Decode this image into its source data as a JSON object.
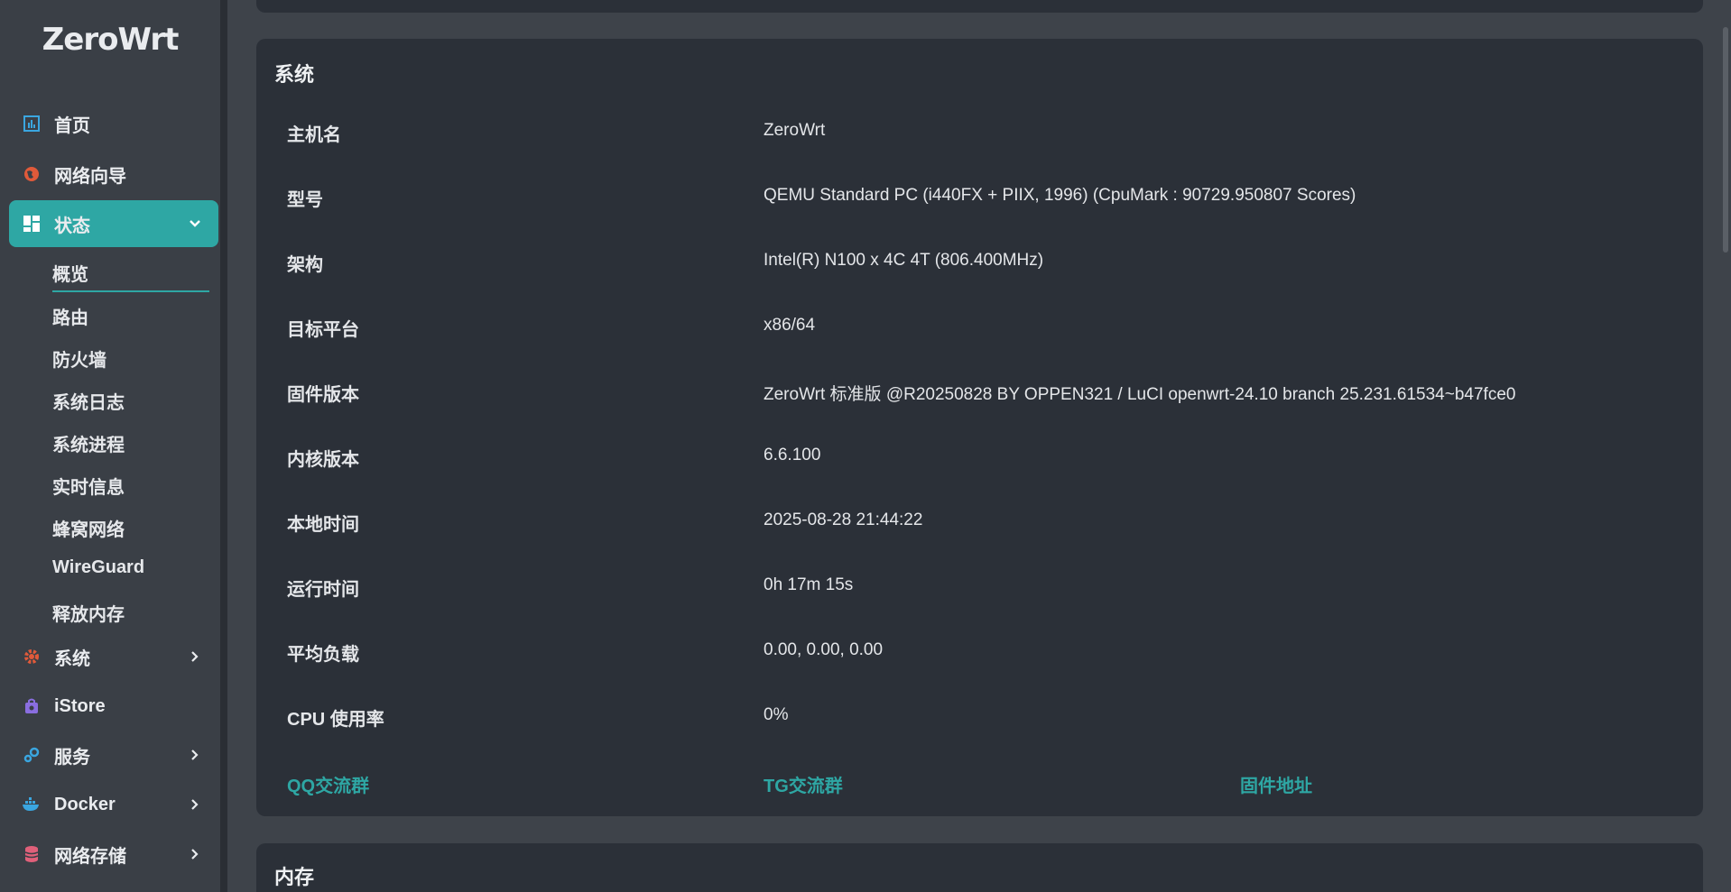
{
  "brand": "ZeroWrt",
  "nav": {
    "home": "首页",
    "wizard": "网络向导",
    "status": "状态",
    "status_sub": [
      "概览",
      "路由",
      "防火墙",
      "系统日志",
      "系统进程",
      "实时信息",
      "蜂窝网络",
      "WireGuard",
      "释放内存"
    ],
    "system": "系统",
    "istore": "iStore",
    "services": "服务",
    "docker": "Docker",
    "nas": "网络存储"
  },
  "system_card": {
    "title": "系统",
    "rows": [
      {
        "label": "主机名",
        "value": "ZeroWrt"
      },
      {
        "label": "型号",
        "value": "QEMU Standard PC (i440FX + PIIX, 1996) (CpuMark : 90729.950807 Scores)"
      },
      {
        "label": "架构",
        "value": "Intel(R) N100 x 4C 4T (806.400MHz)"
      },
      {
        "label": "目标平台",
        "value": "x86/64"
      },
      {
        "label": "固件版本",
        "value": "ZeroWrt 标准版 @R20250828 BY OPPEN321 / LuCI openwrt-24.10 branch 25.231.61534~b47fce0"
      },
      {
        "label": "内核版本",
        "value": "6.6.100"
      },
      {
        "label": "本地时间",
        "value": "2025-08-28 21:44:22"
      },
      {
        "label": "运行时间",
        "value": "0h 17m 15s"
      },
      {
        "label": "平均负载",
        "value": "0.00, 0.00, 0.00"
      },
      {
        "label": "CPU 使用率",
        "value": "0%"
      }
    ],
    "links": [
      "QQ交流群",
      "TG交流群",
      "固件地址"
    ]
  },
  "memory_card": {
    "title": "内存"
  },
  "colors": {
    "accent": "#2ea7a4",
    "card": "#2b3038",
    "sidebar": "#3a3f46",
    "page": "#3e434a"
  },
  "icons": [
    "dashboard-icon",
    "globe-icon",
    "grid-icon",
    "chevron-down-icon",
    "gear-icon",
    "bag-icon",
    "puzzle-icon",
    "docker-icon",
    "database-icon",
    "chevron-right-icon"
  ]
}
